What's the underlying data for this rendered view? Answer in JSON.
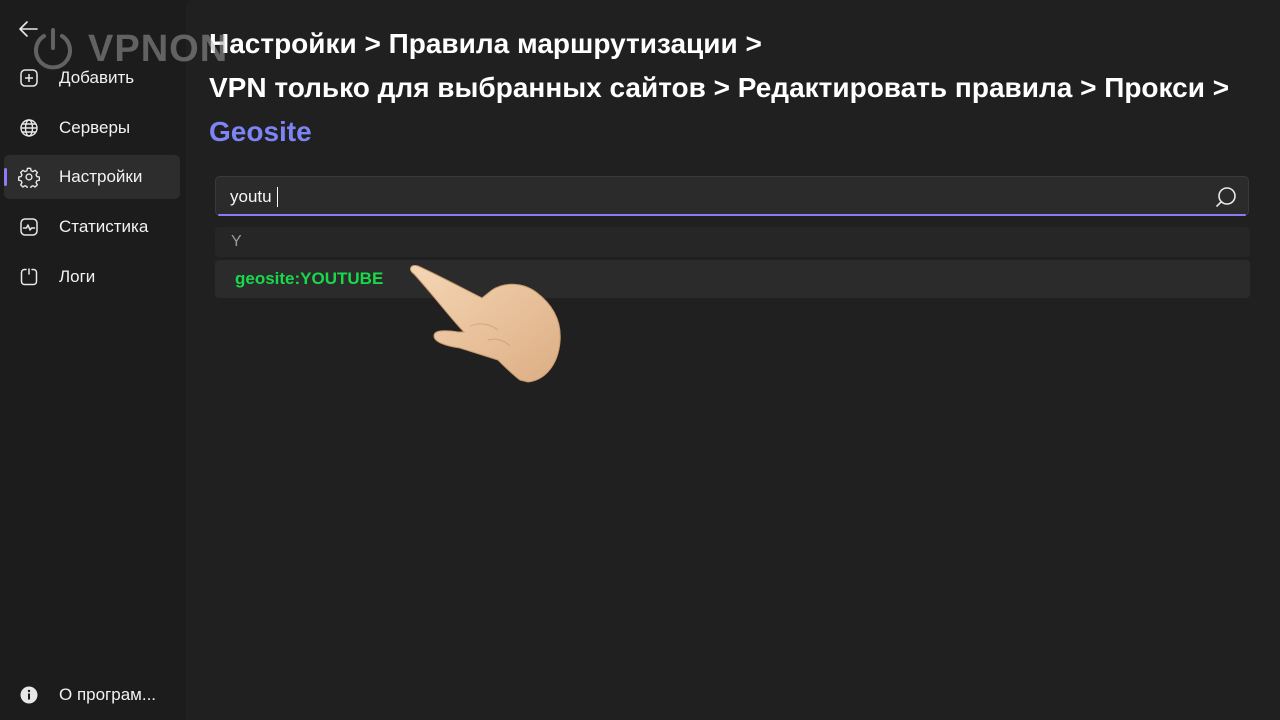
{
  "sidebar": {
    "items": [
      {
        "label": "Добавить",
        "icon": "plus-square-icon"
      },
      {
        "label": "Серверы",
        "icon": "globe-icon"
      },
      {
        "label": "Настройки",
        "icon": "gear-icon",
        "active": true
      },
      {
        "label": "Статистика",
        "icon": "chart-icon"
      },
      {
        "label": "Логи",
        "icon": "log-icon"
      }
    ],
    "about": {
      "label": "О програм...",
      "icon": "info-icon"
    }
  },
  "watermark": {
    "text": "VPNON"
  },
  "breadcrumb": {
    "line1": "Настройки > Правила маршрутизации >",
    "line2": "VPN только для выбранных сайтов > Редактировать правила > Прокси >",
    "current": "Geosite"
  },
  "search": {
    "value": "youtu",
    "placeholder": ""
  },
  "results": {
    "group_header": "Y",
    "items": [
      {
        "label": "geosite:YOUTUBE"
      }
    ]
  },
  "colors": {
    "accent": "#8b7cf6",
    "breadcrumb_current": "#7d84f5",
    "result_text": "#18d94a",
    "background": "#202020"
  }
}
